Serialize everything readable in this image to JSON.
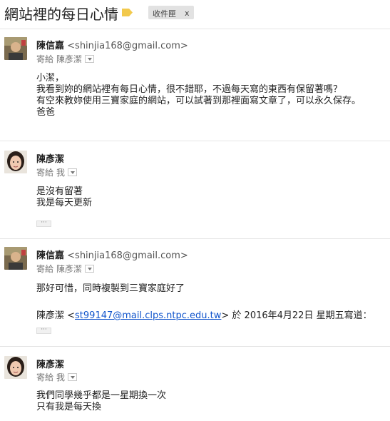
{
  "subject": {
    "title": "網站裡的每日心情",
    "label_icon": "label-tag-icon",
    "label_color": "#f2c94c",
    "inbox_chip": "收件匣",
    "inbox_chip_remove": "x"
  },
  "messages": [
    {
      "sender_name": "陳信嘉",
      "sender_email": "<shinjia168@gmail.com>",
      "recipient_label": "寄給",
      "recipient_name": "陳彥潔",
      "lines": [
        "小潔，",
        "我看到妳的網站裡有每日心情，很不錯耶，不過每天寫的東西有保留著嗎？",
        "有空來教妳使用三寶家庭的網站，可以試著到那裡面寫文章了，可以永久保存。",
        "爸爸"
      ]
    },
    {
      "sender_name": "陳彥潔",
      "recipient_label": "寄給",
      "recipient_name": "我",
      "lines": [
        "是沒有留著",
        "我是每天更新"
      ],
      "ellipsis": "···"
    },
    {
      "sender_name": "陳信嘉",
      "sender_email": "<shinjia168@gmail.com>",
      "recipient_label": "寄給",
      "recipient_name": "陳彥潔",
      "lines": [
        "那好可惜，同時複製到三寶家庭好了"
      ],
      "quote_prefix": "陳彥潔 <",
      "quote_email": "st99147@mail.clps.ntpc.edu.tw",
      "quote_suffix": "> 於 2016年4月22日 星期五寫道：",
      "ellipsis": "···"
    },
    {
      "sender_name": "陳彥潔",
      "recipient_label": "寄給",
      "recipient_name": "我",
      "lines": [
        "我們同學幾乎都是一星期換一次",
        "只有我是每天換"
      ]
    }
  ]
}
